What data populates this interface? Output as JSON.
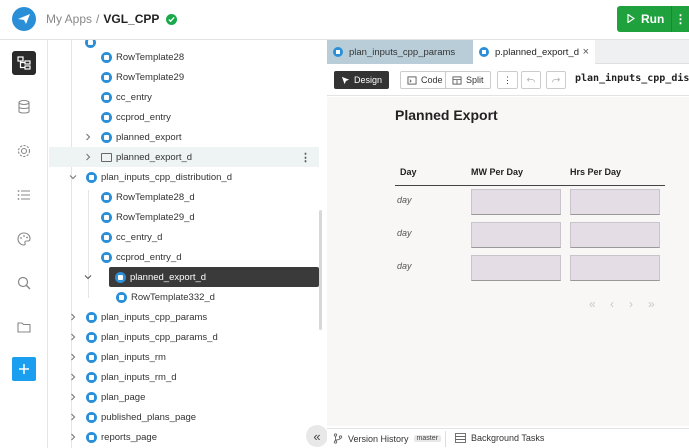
{
  "header": {
    "breadcrumb_root": "My Apps",
    "breadcrumb_sep": "/",
    "app_name": "VGL_CPP",
    "run_label": "Run",
    "more_label": "⋮"
  },
  "rail": {
    "items": [
      "app-tree-icon",
      "database-icon",
      "settings-icon",
      "list-icon",
      "palette-icon",
      "search-icon",
      "folder-icon"
    ],
    "add_icon": "plus-icon"
  },
  "tree": {
    "rows": [
      {
        "label": "RowTemplate28",
        "level": 2,
        "icon": "node"
      },
      {
        "label": "RowTemplate29",
        "level": 2,
        "icon": "node"
      },
      {
        "label": "cc_entry",
        "level": 2,
        "icon": "node"
      },
      {
        "label": "ccprod_entry",
        "level": 2,
        "icon": "node"
      },
      {
        "label": "planned_export",
        "level": 2,
        "icon": "node",
        "chevron": "right"
      },
      {
        "label": "planned_export_d",
        "level": 2,
        "icon": "folder",
        "chevron": "right",
        "state": "hover"
      },
      {
        "label": "plan_inputs_cpp_distribution_d",
        "level": 1,
        "icon": "node",
        "chevron": "down"
      },
      {
        "label": "RowTemplate28_d",
        "level": 2,
        "icon": "node"
      },
      {
        "label": "RowTemplate29_d",
        "level": 2,
        "icon": "node"
      },
      {
        "label": "cc_entry_d",
        "level": 2,
        "icon": "node"
      },
      {
        "label": "ccprod_entry_d",
        "level": 2,
        "icon": "node"
      },
      {
        "label": "planned_export_d",
        "level": 2,
        "icon": "node",
        "chevron": "down",
        "state": "selected"
      },
      {
        "label": "RowTemplate332_d",
        "level": 3,
        "icon": "node"
      },
      {
        "label": "plan_inputs_cpp_params",
        "level": 1,
        "icon": "node",
        "chevron": "right"
      },
      {
        "label": "plan_inputs_cpp_params_d",
        "level": 1,
        "icon": "node",
        "chevron": "right"
      },
      {
        "label": "plan_inputs_rm",
        "level": 1,
        "icon": "node",
        "chevron": "right"
      },
      {
        "label": "plan_inputs_rm_d",
        "level": 1,
        "icon": "node",
        "chevron": "right"
      },
      {
        "label": "plan_page",
        "level": 1,
        "icon": "node",
        "chevron": "right"
      },
      {
        "label": "published_plans_page",
        "level": 1,
        "icon": "node",
        "chevron": "right"
      },
      {
        "label": "reports_page",
        "level": 1,
        "icon": "node",
        "chevron": "right"
      }
    ],
    "collapse_label": "«"
  },
  "tabs": [
    {
      "label": "plan_inputs_cpp_params",
      "active": false
    },
    {
      "label": "p.planned_export_d",
      "active": true,
      "close": "×"
    }
  ],
  "toolbar": {
    "design": "Design",
    "code": "Code",
    "split": "Split",
    "more": "⋮",
    "component_name": "plan_inputs_cpp_distri"
  },
  "canvas": {
    "title": "Planned Export",
    "columns": [
      "Day",
      "MW Per Day",
      "Hrs Per Day"
    ],
    "rows": [
      {
        "day": "day"
      },
      {
        "day": "day"
      },
      {
        "day": "day"
      }
    ],
    "pager": [
      "«",
      "‹",
      "›",
      "»"
    ]
  },
  "statusbar": {
    "version_history": "Version History",
    "branch": "master",
    "background_tasks": "Background Tasks"
  }
}
